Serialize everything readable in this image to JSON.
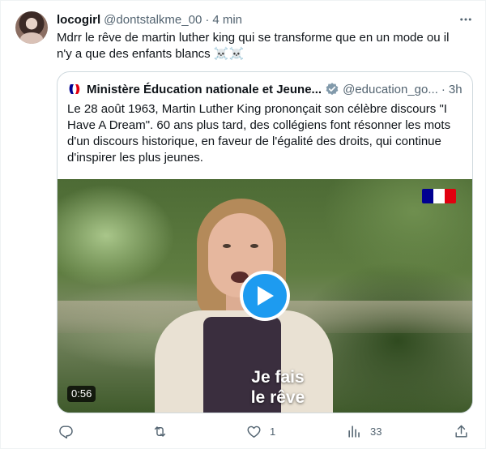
{
  "tweet": {
    "author_name": "locogirl",
    "author_handle": "@dontstalkme_00",
    "dot": "·",
    "time": "4 min",
    "text": "Mdrr le rêve de martin luther king qui se transforme que en un mode ou il n'y a que des enfants blancs ☠️☠️"
  },
  "quote": {
    "author_name": "Ministère Éducation nationale et Jeune...",
    "author_handle": "@education_go...",
    "dot": "·",
    "time": "3h",
    "text": "Le 28 août 1963, Martin Luther King prononçait son célèbre discours \"I Have A Dream\". 60 ans plus tard, des collégiens font résonner les mots d'un discours historique, en faveur de l'égalité des droits, qui continue d'inspirer les plus jeunes.",
    "video": {
      "caption_line1": "Je fais",
      "caption_line2": "le rêve",
      "duration": "0:56"
    }
  },
  "actions": {
    "reply_count": "",
    "retweet_count": "",
    "like_count": "1",
    "views_count": "33"
  },
  "colors": {
    "accent": "#1d9bf0",
    "secondary_text": "#536471",
    "border": "#cfd9de",
    "flag_blue": "#000091",
    "flag_red": "#e1000f"
  },
  "icons": [
    "more-icon",
    "verified-badge-icon",
    "marianne-logo-icon",
    "play-icon",
    "reply-icon",
    "retweet-icon",
    "like-icon",
    "views-icon",
    "share-icon",
    "french-flag-icon"
  ]
}
